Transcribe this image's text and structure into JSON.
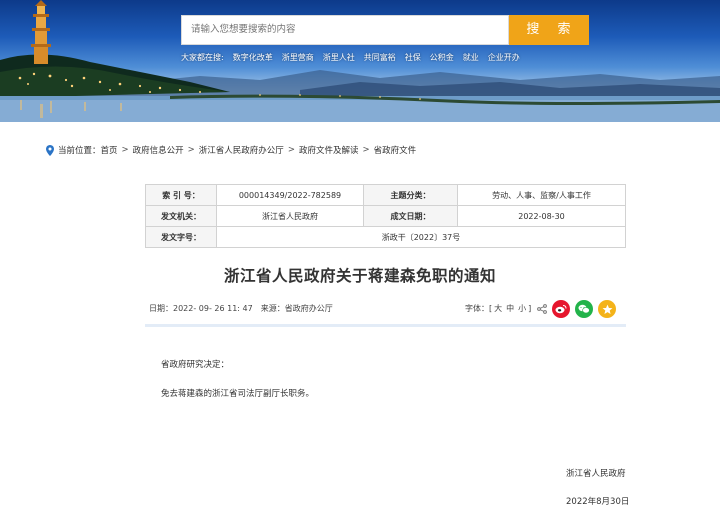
{
  "search": {
    "placeholder": "请输入您想要搜索的内容",
    "button_label": "搜 索"
  },
  "hot_searches": {
    "prefix": "大家都在搜:",
    "items": [
      "数字化改革",
      "浙里营商",
      "浙里人社",
      "共同富裕",
      "社保",
      "公积金",
      "就业",
      "企业开办"
    ]
  },
  "breadcrumb": {
    "label": "当前位置：",
    "items": [
      "首页",
      "政府信息公开",
      "浙江省人民政府办公厅",
      "政府文件及解读",
      "省政府文件"
    ],
    "separator": ">"
  },
  "meta": {
    "index_no_label": "索 引 号：",
    "index_no": "000014349/2022-782589",
    "category_label": "主题分类：",
    "category": "劳动、人事、监察/人事工作",
    "issuer_label": "发文机关：",
    "issuer": "浙江省人民政府",
    "date_label": "成文日期：",
    "date": "2022-08-30",
    "doc_no_label": "发文字号：",
    "doc_no": "浙政干〔2022〕37号"
  },
  "article": {
    "title": "浙江省人民政府关于蒋建森免职的通知",
    "date_text": "日期：2022- 09- 26 11: 47",
    "source_text": "来源：省政府办公厅",
    "font_label": "字体：[",
    "font_large": "大",
    "font_medium": "中",
    "font_small": "小",
    "font_close": "]",
    "paragraphs": [
      "省政府研究决定：",
      "免去蒋建森的浙江省司法厅副厅长职务。"
    ],
    "signature_org": "浙江省人民政府",
    "signature_date": "2022年8月30日"
  },
  "colors": {
    "search_button": "#f0a418",
    "weibo": "#e6162d",
    "wechat": "#22b34a",
    "favorite": "#f4b31a"
  }
}
